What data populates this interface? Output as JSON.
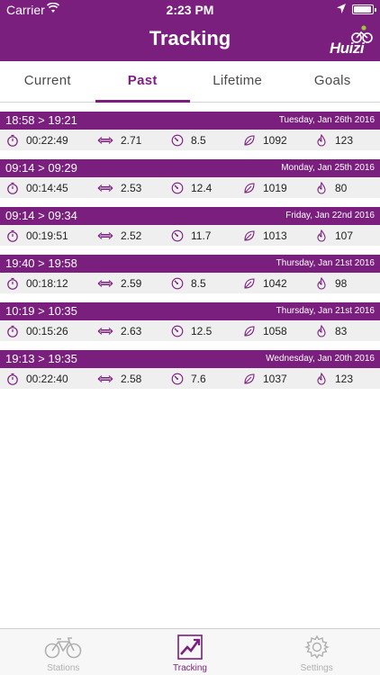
{
  "status": {
    "carrier": "Carrier",
    "time": "2:23 PM"
  },
  "nav": {
    "title": "Tracking",
    "logo_text": "Huizi"
  },
  "tabs": [
    "Current",
    "Past",
    "Lifetime",
    "Goals"
  ],
  "trips": [
    {
      "range": "18:58 > 19:21",
      "date": "Tuesday, Jan 26th 2016",
      "duration": "00:22:49",
      "distance": "2.71",
      "speed": "8.5",
      "calories": "1092",
      "co2": "123"
    },
    {
      "range": "09:14 > 09:29",
      "date": "Monday, Jan 25th 2016",
      "duration": "00:14:45",
      "distance": "2.53",
      "speed": "12.4",
      "calories": "1019",
      "co2": "80"
    },
    {
      "range": "09:14 > 09:34",
      "date": "Friday, Jan 22nd 2016",
      "duration": "00:19:51",
      "distance": "2.52",
      "speed": "11.7",
      "calories": "1013",
      "co2": "107"
    },
    {
      "range": "19:40 > 19:58",
      "date": "Thursday, Jan 21st 2016",
      "duration": "00:18:12",
      "distance": "2.59",
      "speed": "8.5",
      "calories": "1042",
      "co2": "98"
    },
    {
      "range": "10:19 > 10:35",
      "date": "Thursday, Jan 21st 2016",
      "duration": "00:15:26",
      "distance": "2.63",
      "speed": "12.5",
      "calories": "1058",
      "co2": "83"
    },
    {
      "range": "19:13 > 19:35",
      "date": "Wednesday, Jan 20th 2016",
      "duration": "00:22:40",
      "distance": "2.58",
      "speed": "7.6",
      "calories": "1037",
      "co2": "123"
    }
  ],
  "tab_bar": {
    "stations": "Stations",
    "tracking": "Tracking",
    "settings": "Settings"
  },
  "colors": {
    "accent": "#7a1f7e",
    "row_bg": "#efefef",
    "inactive": "#b0b0b0"
  }
}
